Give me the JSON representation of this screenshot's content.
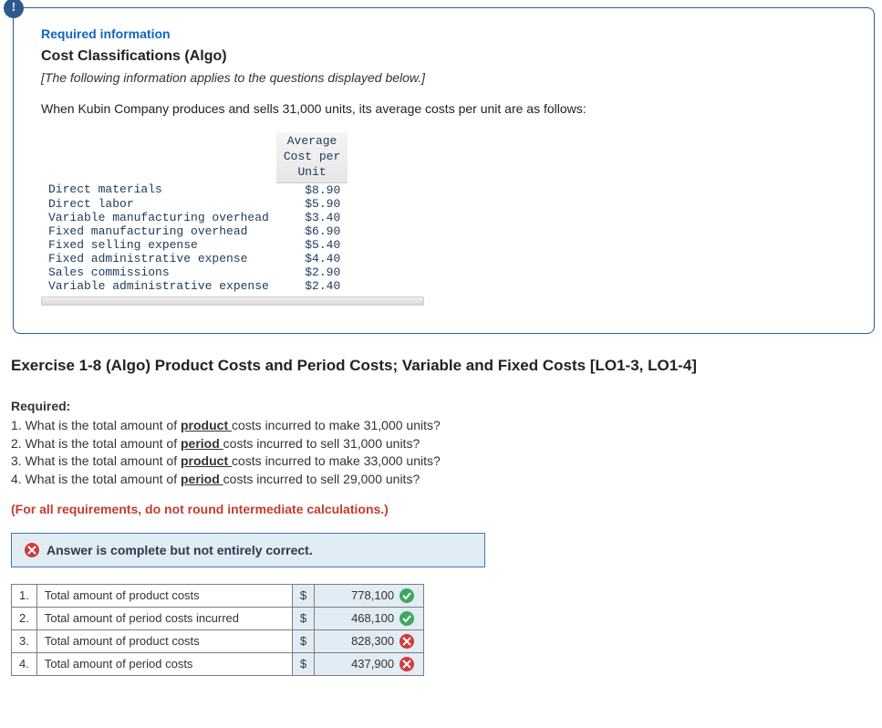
{
  "info_card": {
    "badge_symbol": "!",
    "required_label": "Required information",
    "title": "Cost Classifications (Algo)",
    "italic_note": "[The following information applies to the questions displayed below.]",
    "intro": "When Kubin Company produces and sells 31,000 units, its average costs per unit are as follows:",
    "cost_table": {
      "header_line1": "Average",
      "header_line2": "Cost per",
      "header_line3": "Unit",
      "rows": [
        {
          "label": "Direct materials",
          "value": "$8.90"
        },
        {
          "label": "Direct labor",
          "value": "$5.90"
        },
        {
          "label": "Variable manufacturing overhead",
          "value": "$3.40"
        },
        {
          "label": "Fixed manufacturing overhead",
          "value": "$6.90"
        },
        {
          "label": "Fixed selling expense",
          "value": "$5.40"
        },
        {
          "label": "Fixed administrative expense",
          "value": "$4.40"
        },
        {
          "label": "Sales commissions",
          "value": "$2.90"
        },
        {
          "label": "Variable administrative expense",
          "value": "$2.40"
        }
      ]
    }
  },
  "exercise_title": "Exercise 1-8 (Algo) Product Costs and Period Costs; Variable and Fixed Costs [LO1-3, LO1-4]",
  "required": {
    "heading": "Required:",
    "q1_pre": "1. What is the total amount of ",
    "q1_ul": "product ",
    "q1_post": "costs incurred to make 31,000 units?",
    "q2_pre": "2. What is the total amount of ",
    "q2_ul": "period ",
    "q2_post": "costs incurred to sell 31,000 units?",
    "q3_pre": "3. What is the total amount of ",
    "q3_ul": "product ",
    "q3_post": "costs incurred to make 33,000 units?",
    "q4_pre": "4. What is the total amount of ",
    "q4_ul": "period ",
    "q4_post": "costs incurred to sell 29,000 units?"
  },
  "rounding_note": "(For all requirements, do not round intermediate calculations.)",
  "feedback_banner": "Answer is complete but not entirely correct.",
  "answers": {
    "currency": "$",
    "rows": [
      {
        "n": "1.",
        "label": "Total amount of product costs",
        "value": "778,100",
        "status": "correct"
      },
      {
        "n": "2.",
        "label": "Total amount of period costs incurred",
        "value": "468,100",
        "status": "correct"
      },
      {
        "n": "3.",
        "label": "Total amount of product costs",
        "value": "828,300",
        "status": "incorrect"
      },
      {
        "n": "4.",
        "label": "Total amount of period costs",
        "value": "437,900",
        "status": "incorrect"
      }
    ]
  }
}
